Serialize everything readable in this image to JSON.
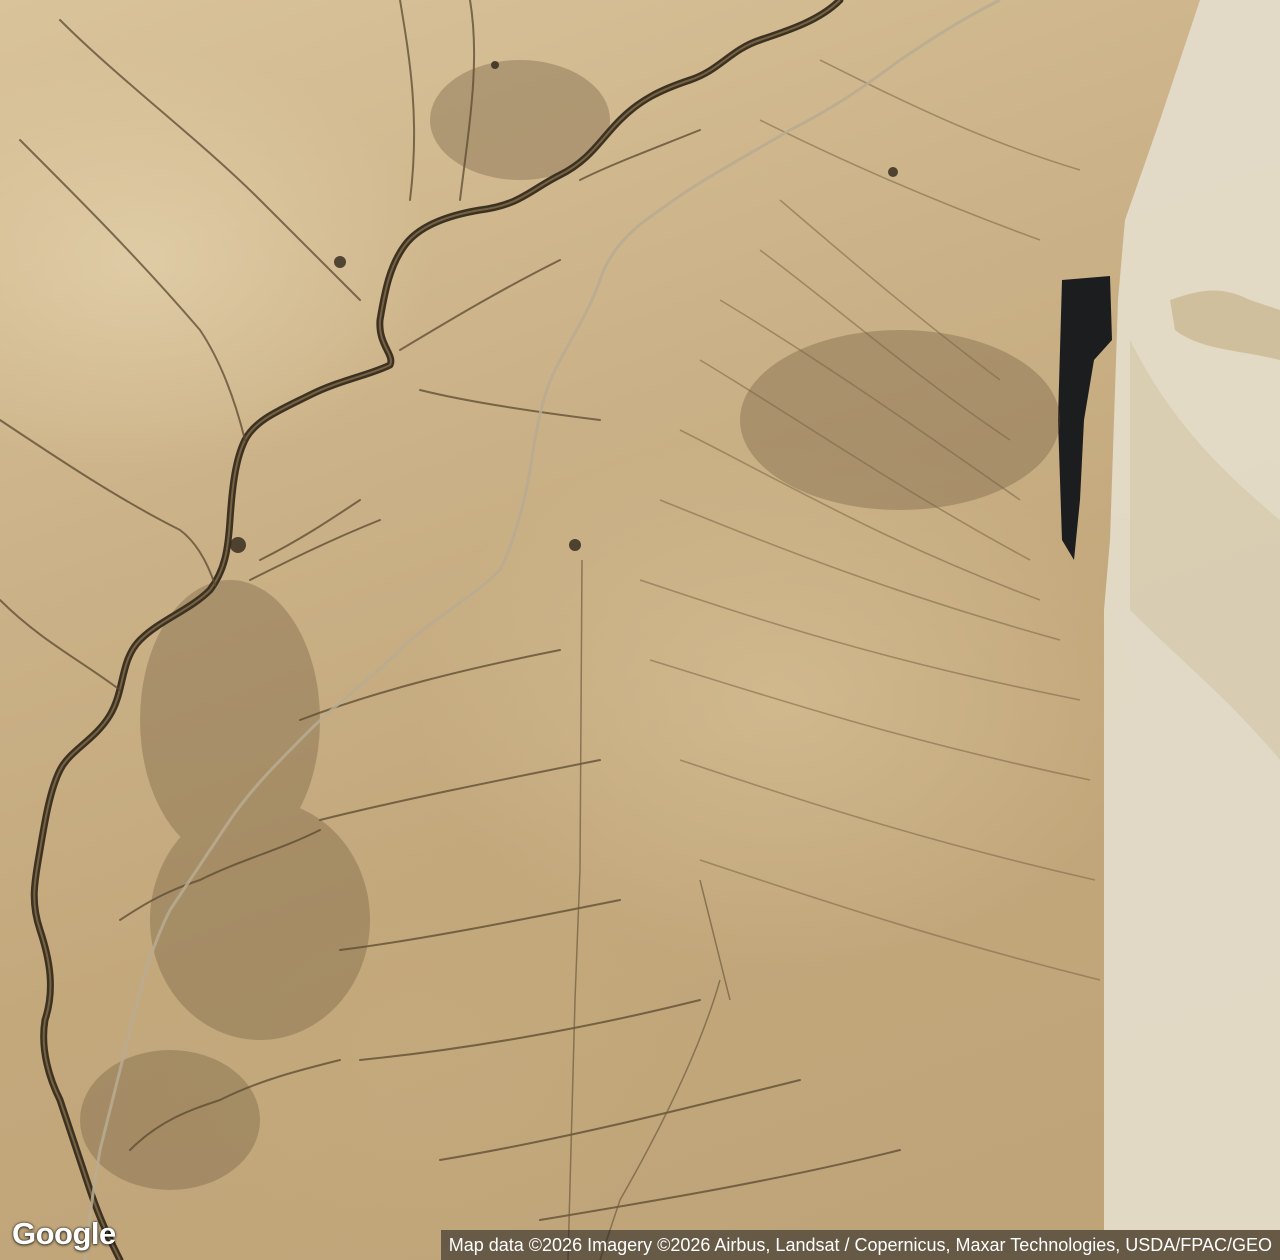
{
  "map": {
    "type": "satellite",
    "provider_logo": "Google",
    "attribution": "Map data ©2026 Imagery ©2026 Airbus, Landsat / Copernicus, Maxar Technologies, USDA/FPAC/GEO",
    "colors": {
      "terrain_light": "#d9c39b",
      "terrain_mid": "#c3a87c",
      "terrain_dark": "#5b4a30",
      "river": "#3d3222",
      "lighter_imagery": "#e6e2d6",
      "shadow": "#1c1d1e"
    }
  }
}
